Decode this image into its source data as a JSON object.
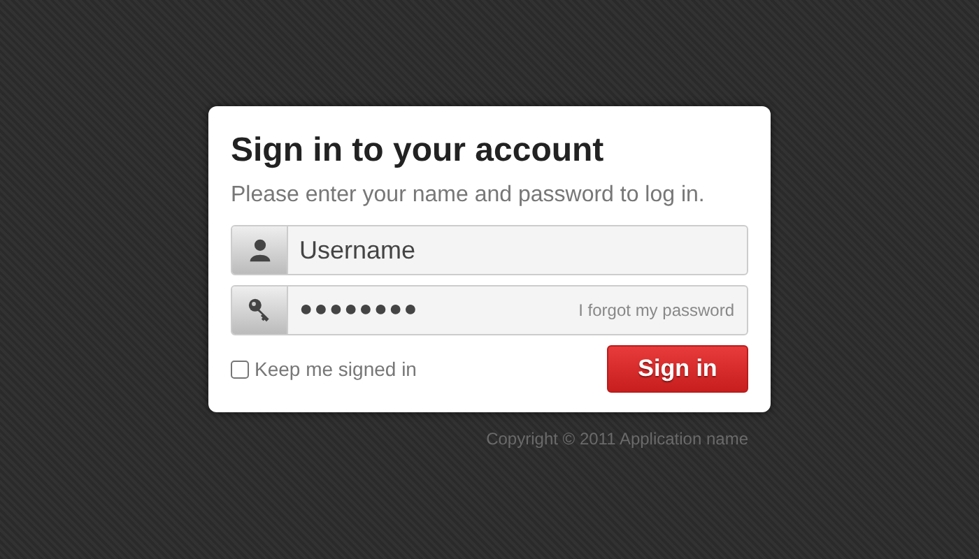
{
  "title": "Sign in to your account",
  "subtitle": "Please enter your name and password to log in.",
  "fields": [
    {
      "kind": "user",
      "value": "Username"
    },
    {
      "kind": "password",
      "value": "●●●●●●●●",
      "link": "I forgot my password"
    }
  ],
  "remember": {
    "label": "Keep me signed in",
    "checked": false
  },
  "button": "Sign in",
  "footer": "Copyright © 2011 Application name"
}
